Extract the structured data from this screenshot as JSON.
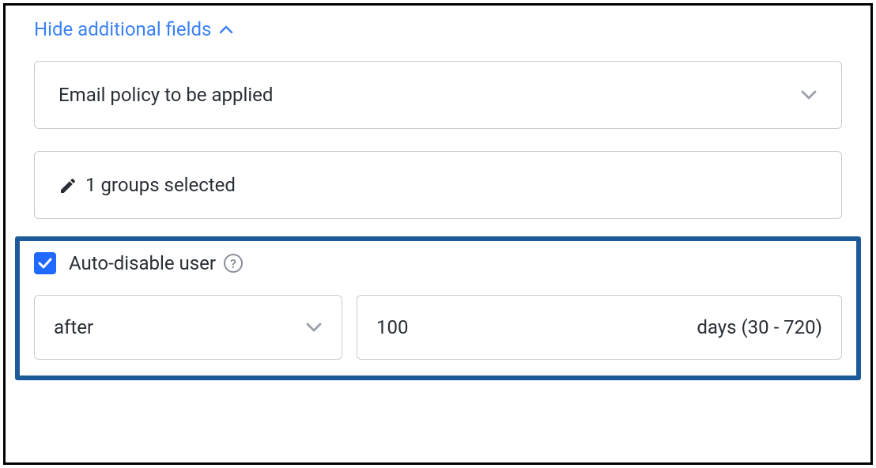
{
  "toggle": {
    "label": "Hide additional fields"
  },
  "emailPolicy": {
    "placeholder": "Email policy to be applied"
  },
  "groups": {
    "text": "1 groups selected"
  },
  "autoDisable": {
    "checked": true,
    "label": "Auto-disable user",
    "timingSelect": "after",
    "daysValue": "100",
    "daysSuffix": "days (30 - 720)"
  }
}
